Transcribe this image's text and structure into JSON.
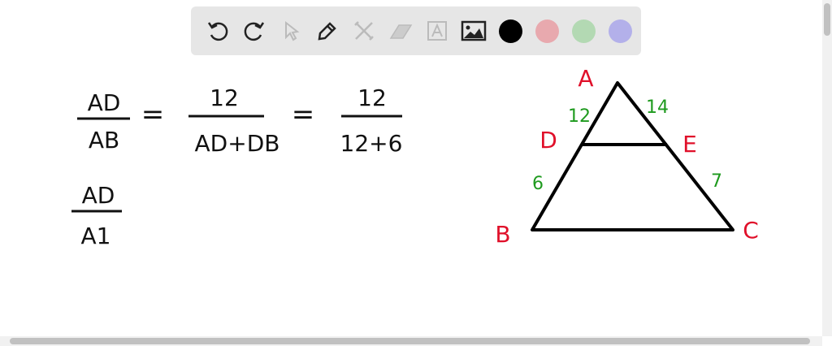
{
  "toolbar": {
    "tools": [
      "undo-icon",
      "redo-icon",
      "select-icon",
      "pen-icon",
      "tools-icon",
      "eraser-icon",
      "text-icon",
      "image-icon"
    ],
    "colors": [
      "#000000",
      "#e8a9ae",
      "#b3d9b3",
      "#b3b0ea"
    ]
  },
  "math": {
    "eq1_num1": "AD",
    "eq1_den1": "AB",
    "eq_sign": "=",
    "eq1_num2": "12",
    "eq1_den2": "AD+DB",
    "eq1_num3": "12",
    "eq1_den3": "12+6",
    "eq2_num": "AD",
    "eq2_den": "A1"
  },
  "triangle": {
    "A": "A",
    "B": "B",
    "C": "C",
    "D": "D",
    "E": "E",
    "AD": "12",
    "AE": "14",
    "DB": "6",
    "EC": "7",
    "vertex_color": "#e0102a",
    "length_color": "#1e9a1e"
  }
}
